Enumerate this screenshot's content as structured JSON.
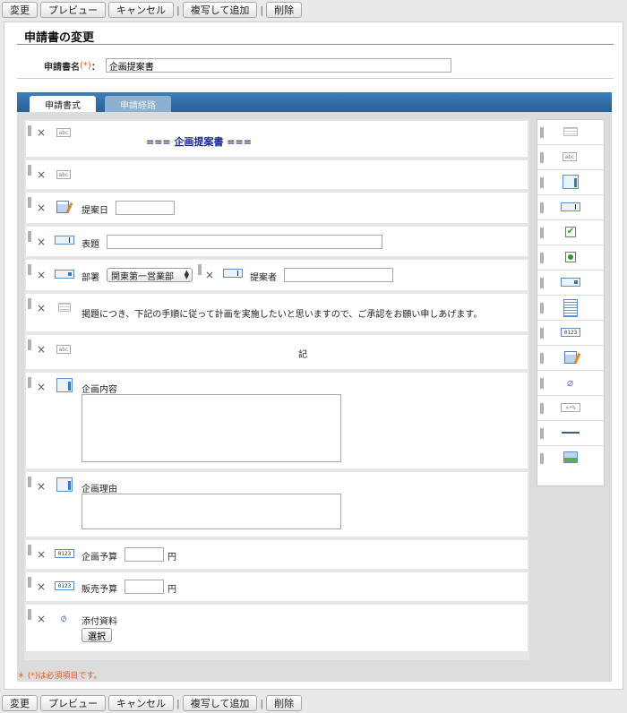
{
  "toolbar": {
    "change": "変更",
    "preview": "プレビュー",
    "cancel": "キャンセル",
    "sep": "|",
    "copy_add": "複写して追加",
    "delete": "削除"
  },
  "page": {
    "title": "申請書の変更",
    "name_label": "申請書名",
    "required_mark": "(*)",
    "colon": "：",
    "name_value": "企画提案書",
    "footnote": "＊ (*)は必須項目です。"
  },
  "tabs": {
    "active": "申請書式",
    "inactive": "申請経路"
  },
  "rows": {
    "header_text": "=== 企画提案書 ===",
    "date_label": "提案日",
    "subject_label": "表題",
    "dept_label": "部署",
    "dept_value": "関東第一営業部",
    "proposer_label": "提案者",
    "paragraph": "掲題につき、下記の手順に従って計画を実施したいと思いますので、ご承認をお願い申しあげます。",
    "ki": "記",
    "content_label": "企画内容",
    "reason_label": "企画理由",
    "budget_label": "企画予算",
    "sales_label": "販売予算",
    "yen": "円",
    "attach_label": "添付資料",
    "select_button": "選択"
  },
  "icons": {
    "delete": "×",
    "abc": "abc",
    "num": "0123",
    "calc": "×+%"
  },
  "colors": {
    "tab_blue": "#3c7fbb",
    "header_text": "#1b2a8a",
    "required": "#e05b1d"
  }
}
